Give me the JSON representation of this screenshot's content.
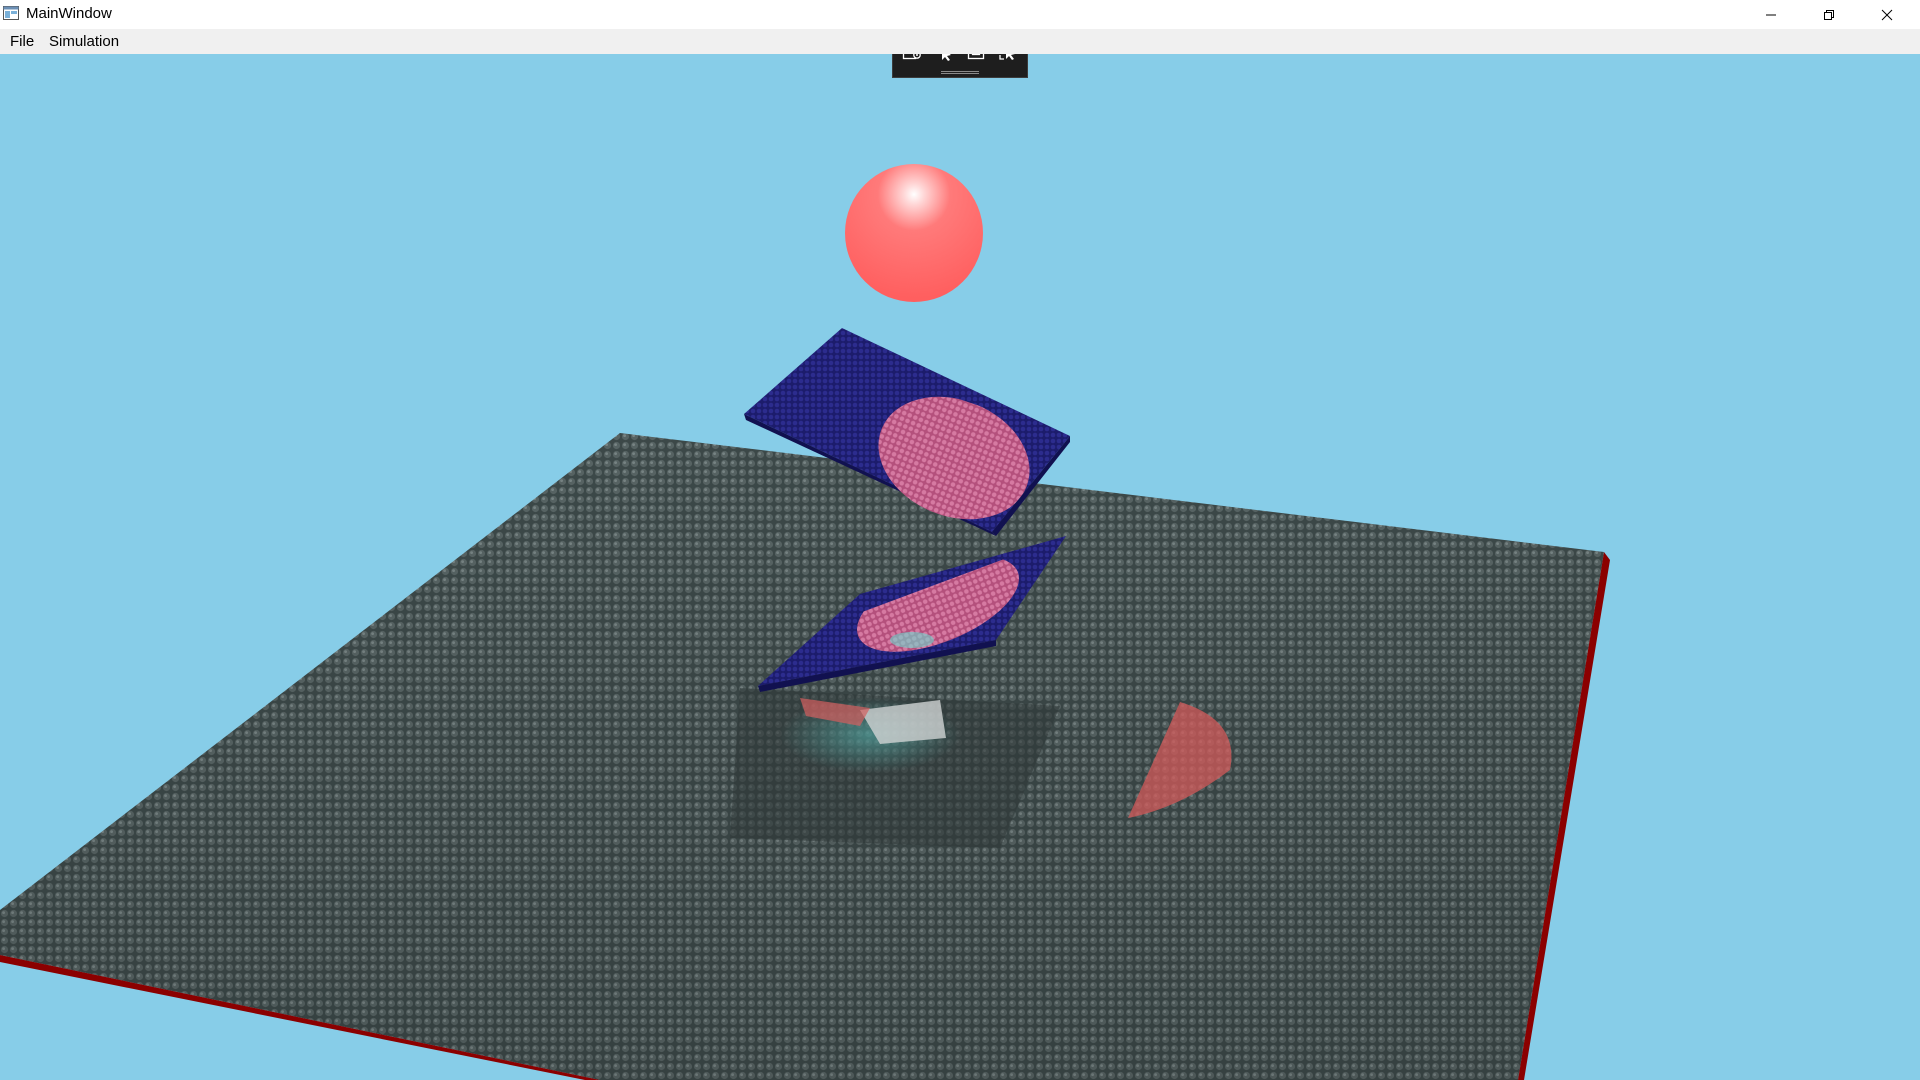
{
  "window": {
    "title": "MainWindow",
    "controls": {
      "minimize_icon": "minimize-icon",
      "restore_icon": "restore-icon",
      "close_icon": "close-icon"
    }
  },
  "menu": {
    "items": [
      {
        "label": "File"
      },
      {
        "label": "Simulation"
      }
    ]
  },
  "debug_toolbar": {
    "buttons": [
      {
        "icon": "live-visual-tree-icon"
      },
      {
        "icon": "select-element-icon"
      },
      {
        "icon": "display-layout-adorners-icon"
      },
      {
        "icon": "track-focused-element-icon"
      }
    ]
  },
  "scene": {
    "sky_color": "#87cde8",
    "floor_color": "#3e4b4b",
    "floor_edge_color": "#8b0000",
    "sphere_color": "#ff6b6b",
    "tile_color": "#20207a",
    "tile_mark_color": "#c65a8a"
  }
}
